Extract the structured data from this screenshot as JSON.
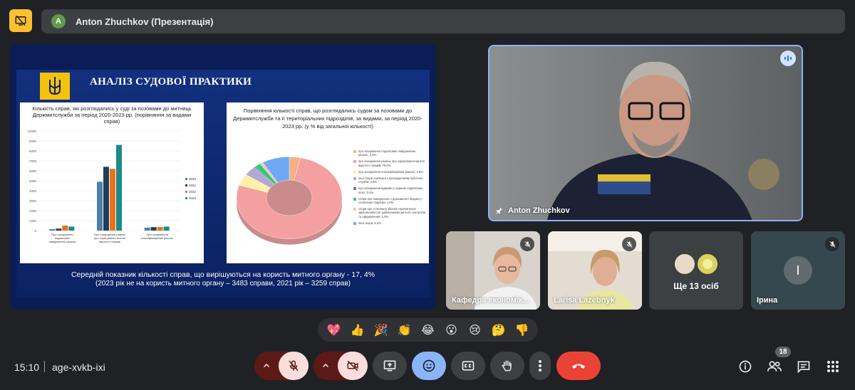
{
  "header": {
    "avatar_letter": "A",
    "presentation_title": "Anton Zhuchkov (Презентація)"
  },
  "slide": {
    "title": "АНАЛІЗ СУДОВОЇ ПРАКТИКИ",
    "bar_chart_title": "Кількість справ, які розглядались у суді за позовами до митниць Держмитслужби за період 2020-2023 рр. (порівняння за видами справ)",
    "donut_chart_title": "Порівняння кількості справ, що розглядались судом за позовами до Держмитслужби та її територіальних підрозділів, за видами, за період 2020-2023 рр. (у % від загальної кількості)",
    "footer_line1": "Середній показник кількості справ, що вирішуються на користь митного органу - 17, 4%",
    "footer_line2": "(2023 рік не на користь митного органу – 3483 справи, 2021 рік – 3259 справ)"
  },
  "chart_data": [
    {
      "type": "bar",
      "title": "Кількість справ, які розглядались у суді за позовами до митниць Держмитслужби за період 2020-2023 рр. (порівняння за видами справ)",
      "categories": [
        "Про оскарження податкових повідомлень-рішень",
        "Про оскарження рішень про коригування митної вартості товарів",
        "Про оскарження класифікаційних рішень"
      ],
      "series": [
        {
          "name": "2020",
          "values": [
            150,
            4900,
            300
          ],
          "color": "#4e7fa6"
        },
        {
          "name": "2021",
          "values": [
            200,
            6400,
            350
          ],
          "color": "#1f3d5c"
        },
        {
          "name": "2022",
          "values": [
            500,
            6200,
            350
          ],
          "color": "#e8711a"
        },
        {
          "name": "2023",
          "values": [
            400,
            8600,
            400
          ],
          "color": "#1b8a8a"
        }
      ],
      "ylim": [
        0,
        10000
      ],
      "yticks": [
        0,
        1000,
        2000,
        3000,
        4000,
        5000,
        6000,
        7000,
        8000,
        9000,
        10000
      ],
      "grid": true,
      "legend": "right"
    },
    {
      "type": "pie",
      "title": "Порівняння кількості справ, що розглядались судом за позовами до Держмитслужби та її територіальних підрозділів, за видами, за період 2020-2023 рр. (у % від загальної кількості)",
      "donut": true,
      "legend": "right",
      "slices": [
        {
          "label": "про оскарження податкових повідомлень-рішень",
          "value": 3.4,
          "color": "#f4b183"
        },
        {
          "label": "про оскарження рішень про коригування митної вартості товарів",
          "value": 76.5,
          "color": "#f4a0a0"
        },
        {
          "label": "про оскарження класифікаційних рішень",
          "value": 4.6,
          "color": "#fff2a8"
        },
        {
          "label": "інші спори пов'язані з проходженням публічної служби",
          "value": 3.8,
          "color": "#b4a7d6"
        },
        {
          "label": "про оскарження відмови у наданні податкових пільг",
          "value": 0.4,
          "color": "#7f6fa6"
        },
        {
          "label": "спори про повернення з державного бюджету сплачених податків",
          "value": 1.8,
          "color": "#2ecc71"
        },
        {
          "label": "спори про стягнення збитків спричинених здійсненням (не здійсненням) митного контролю та оформлення",
          "value": 1.0,
          "color": "#f8c0c0"
        },
        {
          "label": "інші спори",
          "value": 8.4,
          "color": "#6fa8f5"
        }
      ],
      "legend_text": [
        "про оскарження податкових повідомлень-рішень; 3,4%",
        "про оскарження рішень про коригування митної вартості товарів; 76,5%",
        "про оскарження класифікаційних рішень; 4,6%",
        "інші спори пов'язані з проходженням публічної служби; 3,8%",
        "про оскарження відмови у наданні податкових пільг; 0,4%",
        "спори про повернення з державного бюджету сплачених податків; 1,8%",
        "спори про стягнення збитків спричинених здійсненням (не здійсненням) митного контролю та оформлення; 1,0%",
        "інші спори; 8,4%"
      ]
    }
  ],
  "participants": {
    "main_name": "Anton Zhuchkov",
    "tile1_name": "Кафедра економік...",
    "tile2_name": "Larisa Lazebnyk",
    "tile3_label": "Ще 13 осіб",
    "tile4_initial": "І",
    "tile4_name": "Ірина",
    "count": "18"
  },
  "reactions": [
    "💖",
    "👍",
    "🎉",
    "👏",
    "😂",
    "😮",
    "😢",
    "🤔",
    "👎"
  ],
  "meeting": {
    "time": "15:10",
    "code": "age-xvkb-ixi"
  },
  "colors": {
    "accent_yellow": "#fbc02d",
    "end_call_red": "#ea4335",
    "active_blue": "#8ab4f8",
    "muted_bg": "#f9dedc"
  }
}
